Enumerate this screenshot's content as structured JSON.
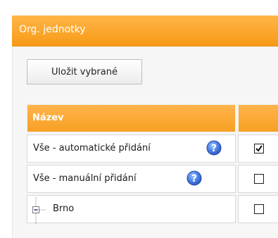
{
  "panel": {
    "title": "Org. jednotky"
  },
  "toolbar": {
    "save_label": "Uložit vybrané"
  },
  "table": {
    "columns": [
      "Název",
      ""
    ],
    "rows": [
      {
        "name": "Vše - automatické přidání",
        "has_help": true,
        "checked": true
      },
      {
        "name": "Vše - manuální přidání",
        "has_help": true,
        "checked": false
      },
      {
        "name": "Brno",
        "tree_node": "collapse",
        "checked": false
      }
    ]
  },
  "colors": {
    "header_orange": "#f7a023",
    "help_icon_blue": "#3b6fd8"
  },
  "icons": {
    "help": "question-mark-circle-icon",
    "tree": "tree-collapse-icon"
  }
}
